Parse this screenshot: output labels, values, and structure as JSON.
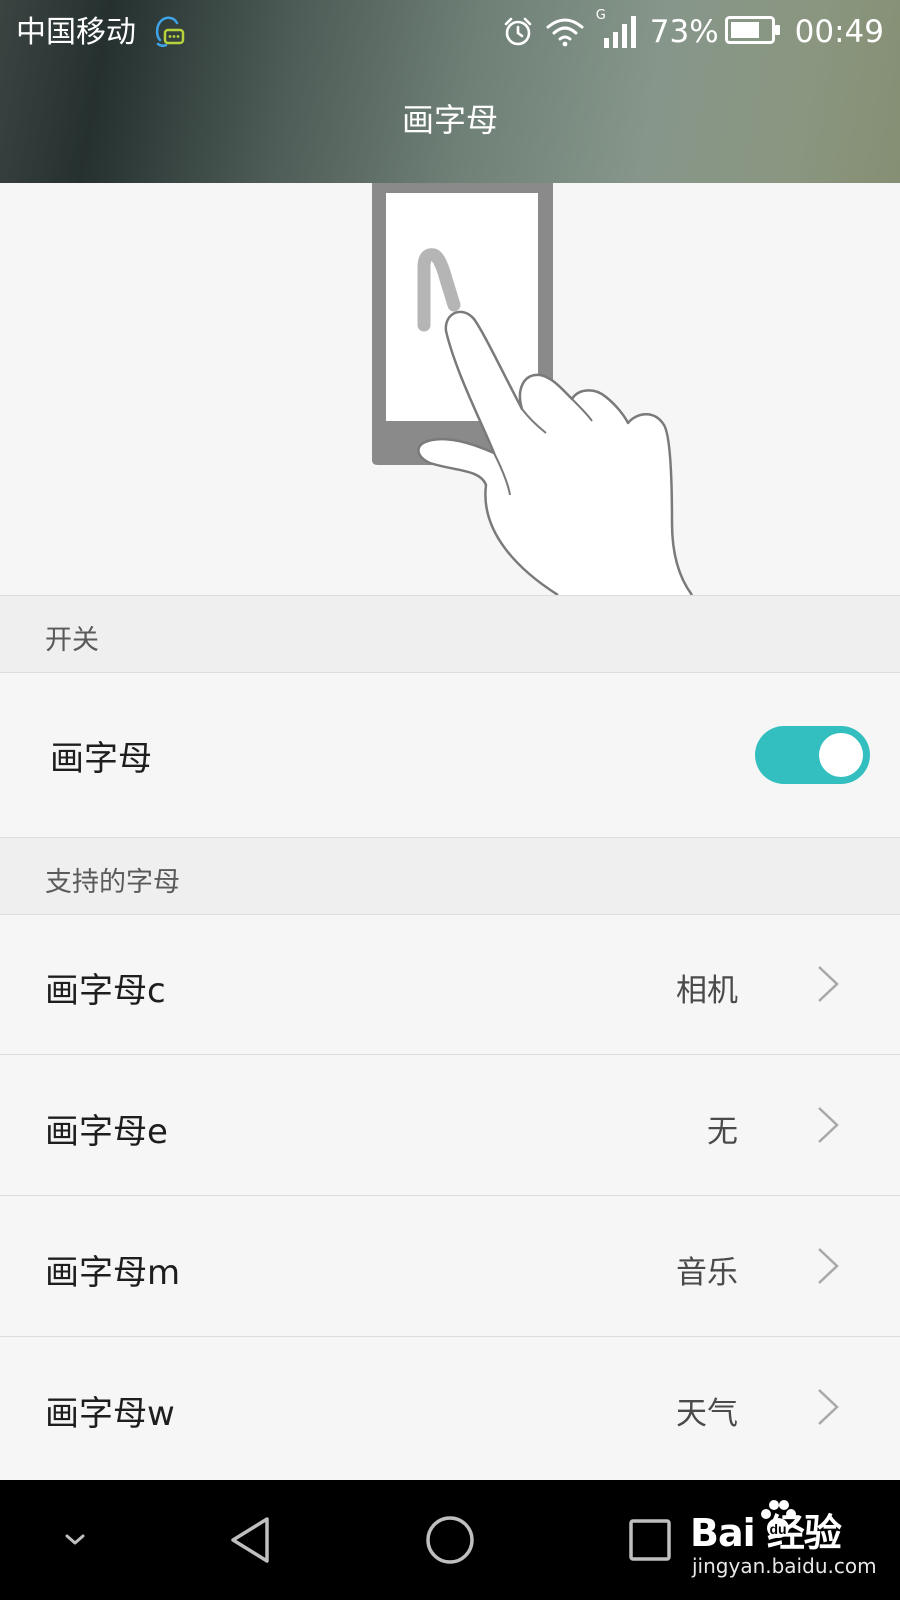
{
  "status_bar": {
    "carrier": "中国移动",
    "network_type": "G",
    "battery_percent": "73%",
    "time": "00:49",
    "icons": [
      "chat-notification-icon",
      "alarm-icon",
      "wifi-icon",
      "signal-icon",
      "battery-icon"
    ]
  },
  "header": {
    "title": "画字母"
  },
  "illustration": {
    "icon": "phone-draw-gesture-illustration"
  },
  "section_switch": {
    "label": "开关"
  },
  "toggle": {
    "label": "画字母",
    "enabled": true,
    "color": "#33bfbf"
  },
  "section_letters": {
    "label": "支持的字母"
  },
  "letters": [
    {
      "label": "画字母c",
      "value": "相机"
    },
    {
      "label": "画字母e",
      "value": "无"
    },
    {
      "label": "画字母m",
      "value": "音乐"
    },
    {
      "label": "画字母w",
      "value": "天气"
    }
  ],
  "navbar": {
    "buttons": [
      "collapse-icon",
      "back-icon",
      "home-icon",
      "recents-icon"
    ]
  },
  "watermark": {
    "main": "Bai  经验",
    "sub": "jingyan.baidu.com"
  }
}
